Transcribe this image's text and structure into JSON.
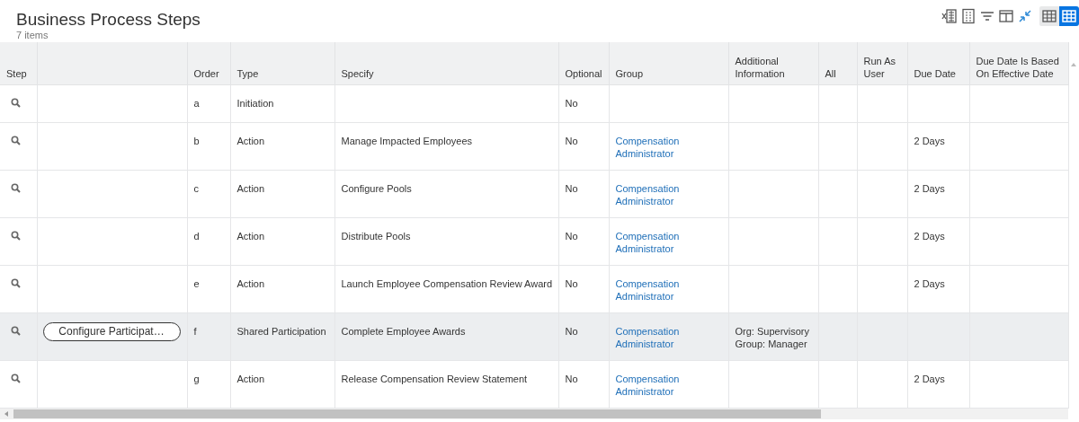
{
  "title": "Business Process Steps",
  "item_count": "7 items",
  "toolbar": [
    {
      "kind": "excel"
    },
    {
      "kind": "pdf"
    },
    {
      "kind": "filter"
    },
    {
      "kind": "columns"
    },
    {
      "kind": "collapse"
    }
  ],
  "views": [
    {
      "kind": "table",
      "selected": false
    },
    {
      "kind": "grid",
      "selected": true
    }
  ],
  "table": {
    "columns": [
      "Step",
      "Order",
      "Type",
      "Specify",
      "Optional",
      "Group",
      "Additional Information",
      "All",
      "Run As User",
      "Due Date",
      "Due Date Is Based On Effective Date"
    ],
    "rows": [
      {
        "order": "a",
        "type": "Initiation",
        "optional": "No",
        "selected": false
      },
      {
        "order": "b",
        "type": "Action",
        "specify": "Manage Impacted Employees",
        "optional": "No",
        "group": "Compensation Administrator",
        "due_date": "2 Days",
        "selected": false
      },
      {
        "order": "c",
        "type": "Action",
        "specify": "Configure Pools",
        "optional": "No",
        "group": "Compensation Administrator",
        "due_date": "2 Days",
        "selected": false
      },
      {
        "order": "d",
        "type": "Action",
        "specify": "Distribute Pools",
        "optional": "No",
        "group": "Compensation Administrator",
        "due_date": "2 Days",
        "selected": false
      },
      {
        "order": "e",
        "type": "Action",
        "specify": "Launch Employee Compensation Review Award",
        "optional": "No",
        "group": "Compensation Administrator",
        "due_date": "2 Days",
        "selected": false
      },
      {
        "button": "Configure Participat…",
        "order": "f",
        "type": "Shared Participation",
        "specify": "Complete Employee Awards",
        "optional": "No",
        "group": "Compensation Administrator",
        "additional_information": "Org: Supervisory Group: Manager",
        "selected": true
      },
      {
        "order": "g",
        "type": "Action",
        "specify": "Release Compensation Review Statement",
        "optional": "No",
        "group": "Compensation Administrator",
        "due_date": "2 Days",
        "selected": false
      }
    ]
  }
}
